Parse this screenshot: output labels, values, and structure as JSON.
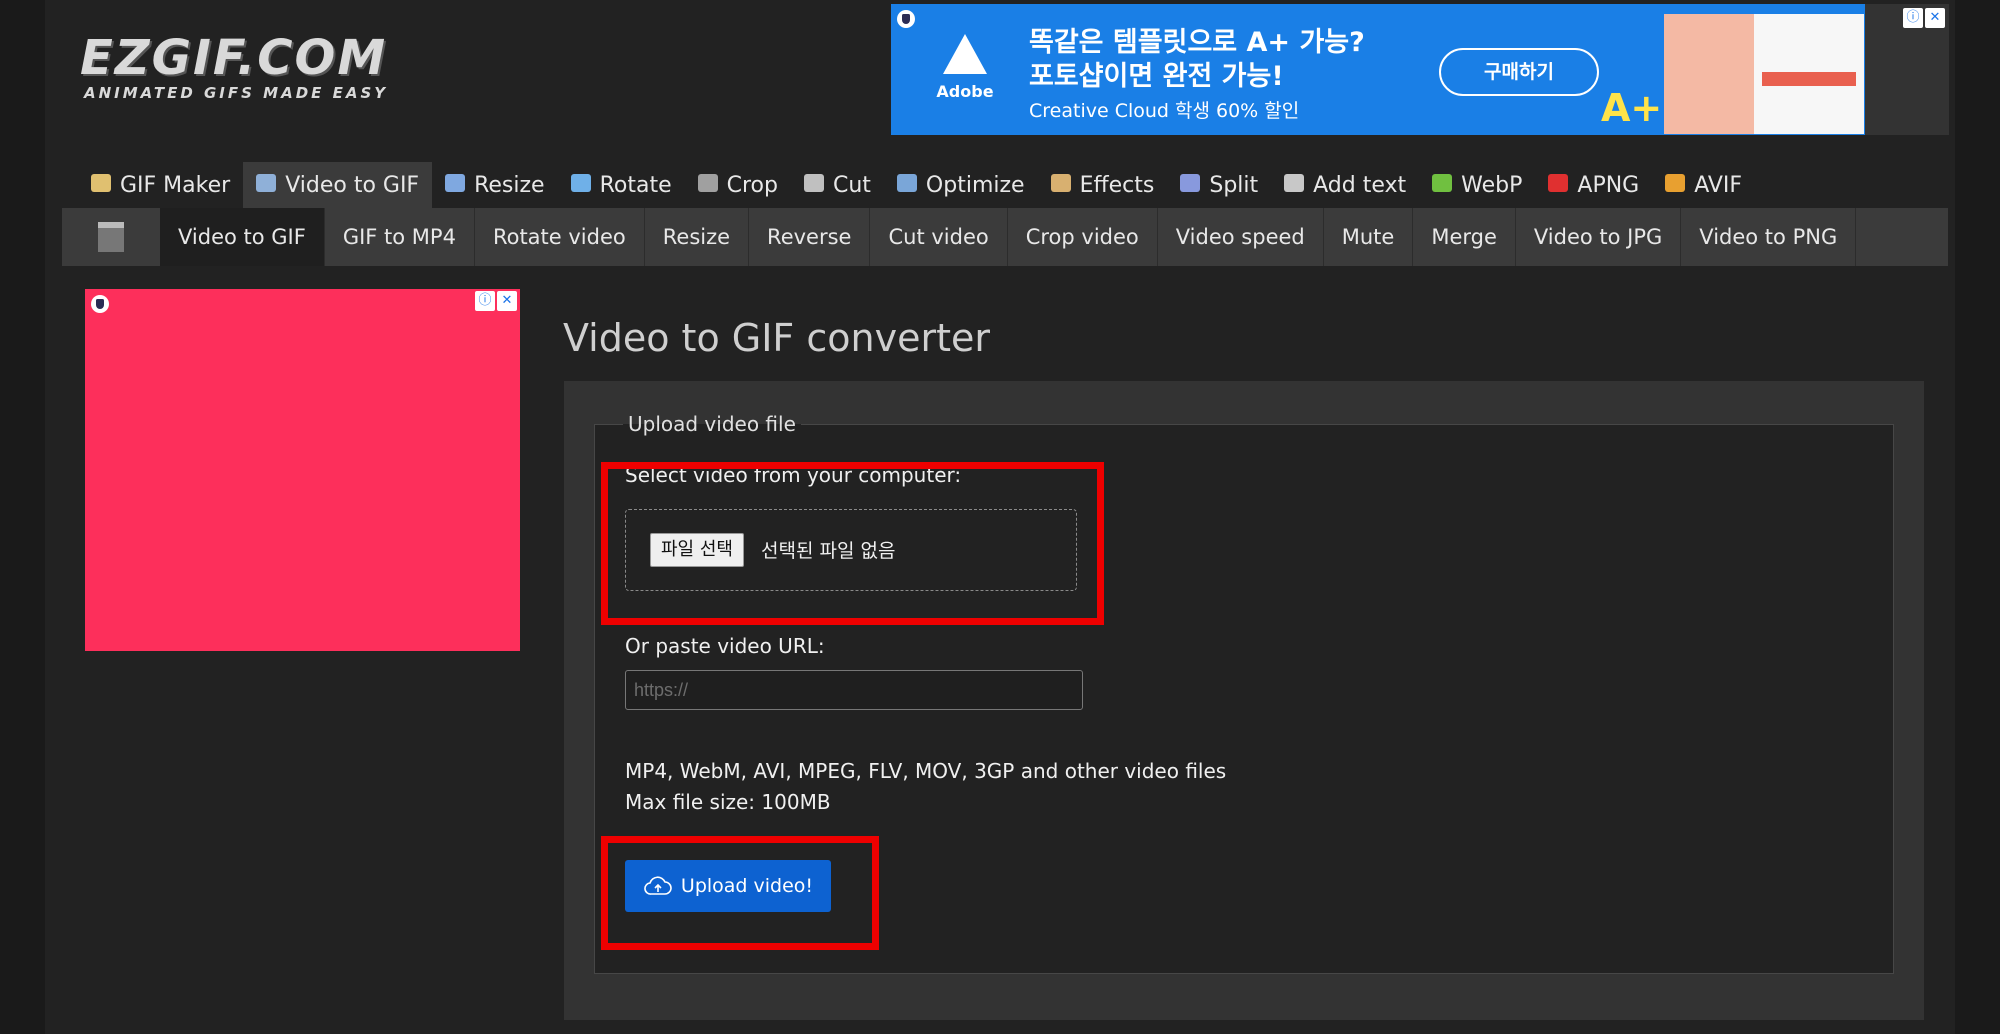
{
  "logo": {
    "title": "EZGIF.COM",
    "tagline": "ANIMATED GIFS MADE EASY"
  },
  "top_ad": {
    "brand": "Adobe",
    "headline_1": "똑같은 템플릿으로 A+ 가능?",
    "headline_2": "포토샵이면 완전 가능!",
    "subline": "Creative Cloud 학생 60% 할인",
    "button": "구매하기",
    "badge": "A+"
  },
  "main_nav": [
    {
      "label": "GIF Maker",
      "icon": "gif-maker-icon",
      "color": "#e0c070"
    },
    {
      "label": "Video to GIF",
      "icon": "video-icon",
      "color": "#8fb0d8",
      "active": true
    },
    {
      "label": "Resize",
      "icon": "resize-icon",
      "color": "#7fa8e0"
    },
    {
      "label": "Rotate",
      "icon": "rotate-icon",
      "color": "#6fb0e8"
    },
    {
      "label": "Crop",
      "icon": "crop-icon",
      "color": "#a0a0a0"
    },
    {
      "label": "Cut",
      "icon": "cut-icon",
      "color": "#c0c0c0"
    },
    {
      "label": "Optimize",
      "icon": "optimize-icon",
      "color": "#7aa6d8"
    },
    {
      "label": "Effects",
      "icon": "effects-icon",
      "color": "#d8b070"
    },
    {
      "label": "Split",
      "icon": "split-icon",
      "color": "#8899dd"
    },
    {
      "label": "Add text",
      "icon": "add-text-icon",
      "color": "#c8c8c8"
    },
    {
      "label": "WebP",
      "icon": "webp-icon",
      "color": "#70c040"
    },
    {
      "label": "APNG",
      "icon": "apng-icon",
      "color": "#e03030"
    },
    {
      "label": "AVIF",
      "icon": "avif-icon",
      "color": "#e8a030"
    }
  ],
  "sub_nav": [
    {
      "label": "Video to GIF",
      "active": true
    },
    {
      "label": "GIF to MP4"
    },
    {
      "label": "Rotate video"
    },
    {
      "label": "Resize"
    },
    {
      "label": "Reverse"
    },
    {
      "label": "Cut video"
    },
    {
      "label": "Crop video"
    },
    {
      "label": "Video speed"
    },
    {
      "label": "Mute"
    },
    {
      "label": "Merge"
    },
    {
      "label": "Video to JPG"
    },
    {
      "label": "Video to PNG"
    }
  ],
  "page_title": "Video to GIF converter",
  "form": {
    "legend": "Upload video file",
    "select_label": "Select video from your computer:",
    "file_button": "파일 선택",
    "file_status": "선택된 파일 없음",
    "url_label": "Or paste video URL:",
    "url_placeholder": "https://",
    "formats": "MP4, WebM, AVI, MPEG, FLV, MOV, 3GP and other video files",
    "max_size": "Max file size: 100MB",
    "upload_button": "Upload video!"
  },
  "colors": {
    "accent": "#0d62d1",
    "highlight": "#ee0000",
    "left_ad": "#fd2f5b",
    "top_ad": "#1a7fe6"
  }
}
